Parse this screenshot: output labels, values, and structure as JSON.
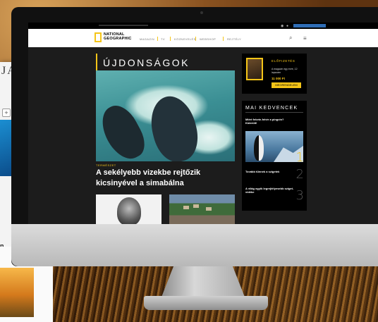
{
  "background": {
    "left_window_letters": "JA",
    "left_window_n": "n"
  },
  "topbar": {
    "search_icon": "search-icon",
    "menu_icon": "menu-icon"
  },
  "brand": {
    "line1": "NATIONAL",
    "line2": "GEOGRAPHIC",
    "accent": "#f5c518"
  },
  "nav": {
    "items": [
      "MAGAZIN",
      "TV",
      "KÖZNEVELÉS",
      "WEBSHOP",
      "REJTÉLY"
    ]
  },
  "section": {
    "title": "ÚJDONSÁGOK"
  },
  "hero": {
    "category": "TERMÉSZET",
    "headline": "A sekélyebb vizekbe rejtőzik kicsinyével a simabálna"
  },
  "promo": {
    "title": "ELŐFIZETÉS",
    "desc": "A magazin egy évre, 12 lapszám",
    "price": "11 000 Ft",
    "button": "MEGRENDELEM"
  },
  "favorites": {
    "title": "MAI KEDVENCEK",
    "items": [
      {
        "text": "Miért fekete-fehér a pingvin? Kiderült!",
        "num": "1"
      },
      {
        "text": "Tovább tűnnek a szigetek",
        "num": "2"
      },
      {
        "text": "A világ egyik legrejtélyesebb sziget-vidéke",
        "num": "3"
      }
    ]
  }
}
